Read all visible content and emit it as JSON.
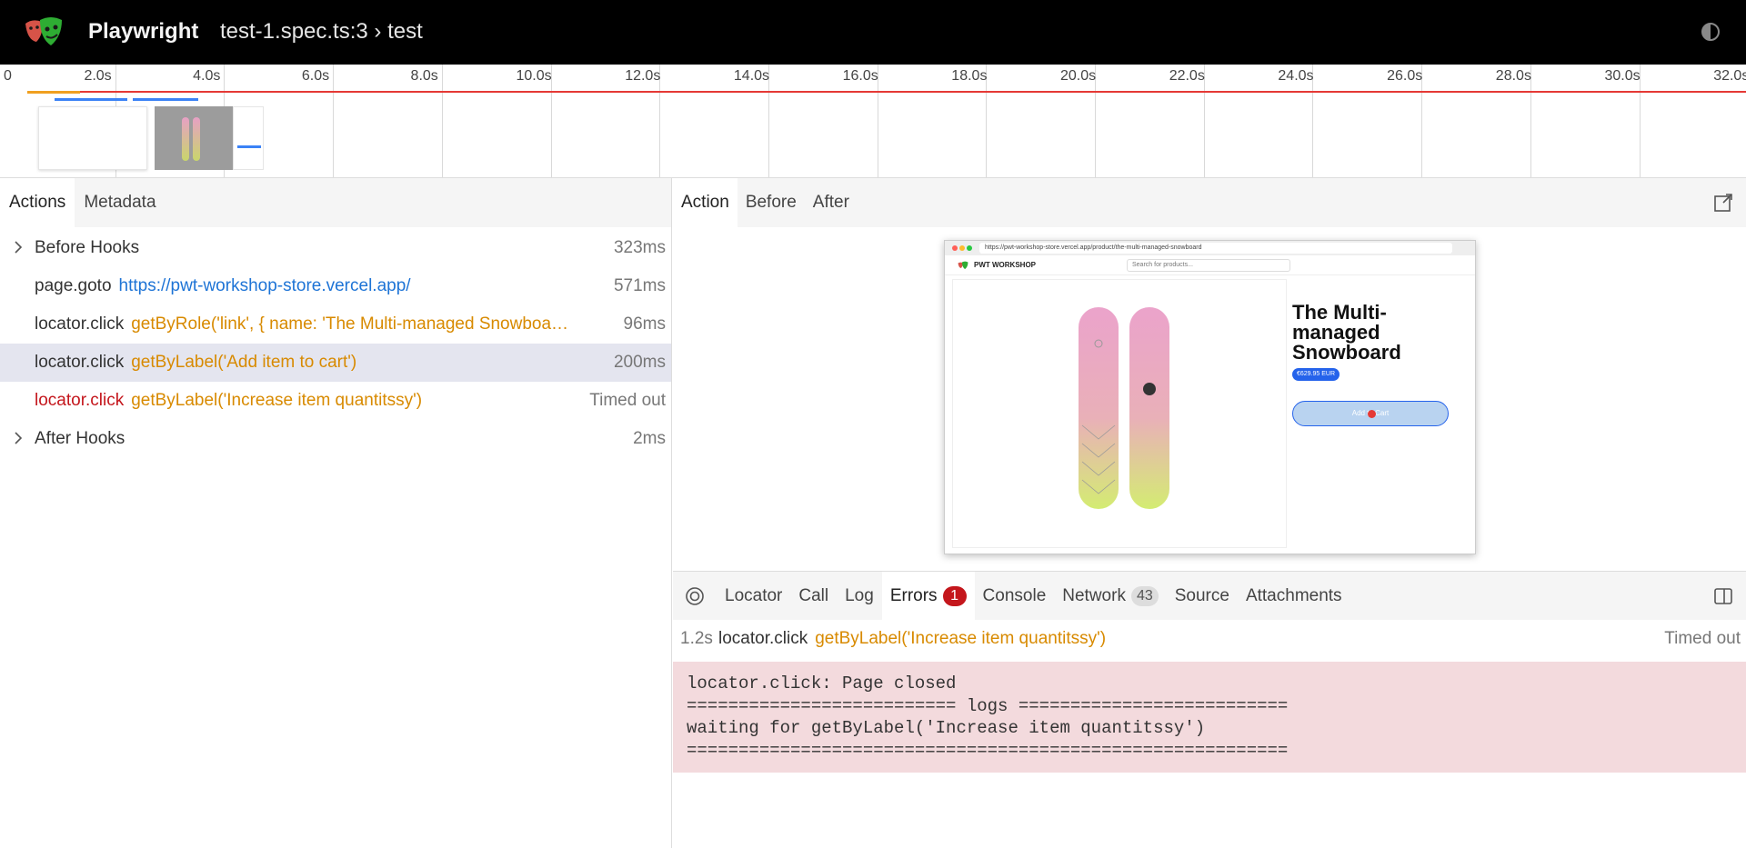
{
  "header": {
    "app_title": "Playwright",
    "test_title": "test-1.spec.ts:3 › test",
    "theme_icon": "contrast-icon"
  },
  "timeline": {
    "ticks": [
      "0",
      "2.0s",
      "4.0s",
      "6.0s",
      "8.0s",
      "10.0s",
      "12.0s",
      "14.0s",
      "16.0s",
      "18.0s",
      "20.0s",
      "22.0s",
      "24.0s",
      "26.0s",
      "28.0s",
      "30.0s",
      "32.0s"
    ],
    "colors": {
      "error_line": "#e53935",
      "nav_bar": "#f0a020",
      "action_bar": "#3b82f6"
    }
  },
  "left_panel": {
    "tabs": [
      {
        "label": "Actions",
        "active": true
      },
      {
        "label": "Metadata",
        "active": false
      }
    ],
    "actions": [
      {
        "title": "Before Hooks",
        "selector": "",
        "url": "",
        "duration": "323ms",
        "expandable": true,
        "selected": false,
        "error": false
      },
      {
        "title": "page.goto",
        "selector": "",
        "url": "https://pwt-workshop-store.vercel.app/",
        "duration": "571ms",
        "expandable": false,
        "selected": false,
        "error": false
      },
      {
        "title": "locator.click",
        "selector": "getByRole('link', { name: 'The Multi-managed Snowboa…",
        "url": "",
        "duration": "96ms",
        "expandable": false,
        "selected": false,
        "error": false
      },
      {
        "title": "locator.click",
        "selector": "getByLabel('Add item to cart')",
        "url": "",
        "duration": "200ms",
        "expandable": false,
        "selected": true,
        "error": false
      },
      {
        "title": "locator.click",
        "selector": "getByLabel('Increase item quantitssy')",
        "url": "",
        "duration": "Timed out",
        "expandable": false,
        "selected": false,
        "error": true
      },
      {
        "title": "After Hooks",
        "selector": "",
        "url": "",
        "duration": "2ms",
        "expandable": true,
        "selected": false,
        "error": false
      }
    ]
  },
  "right_panel": {
    "tabs": [
      {
        "label": "Action",
        "active": true
      },
      {
        "label": "Before",
        "active": false
      },
      {
        "label": "After",
        "active": false
      }
    ],
    "popout_icon": "external-link-icon",
    "snapshot": {
      "url": "https://pwt-workshop-store.vercel.app/product/the-multi-managed-snowboard",
      "site_name": "PWT WORKSHOP",
      "search_placeholder": "Search for products...",
      "product_title": "The Multi-managed Snowboard",
      "price": "€629.95 EUR",
      "add_to_cart": "Add to Cart"
    },
    "bottom_tabs": [
      {
        "label": "Locator",
        "badge": ""
      },
      {
        "label": "Call",
        "badge": ""
      },
      {
        "label": "Log",
        "badge": ""
      },
      {
        "label": "Errors",
        "badge": "1",
        "active": true
      },
      {
        "label": "Console",
        "badge": ""
      },
      {
        "label": "Network",
        "badge": "43"
      },
      {
        "label": "Source",
        "badge": ""
      },
      {
        "label": "Attachments",
        "badge": ""
      }
    ],
    "error_entry": {
      "time": "1.2s",
      "title": "locator.click",
      "selector": "getByLabel('Increase item quantitssy')",
      "status": "Timed out"
    },
    "error_message": "locator.click: Page closed\n========================== logs ==========================\nwaiting for getByLabel('Increase item quantitssy')\n=========================================================="
  }
}
